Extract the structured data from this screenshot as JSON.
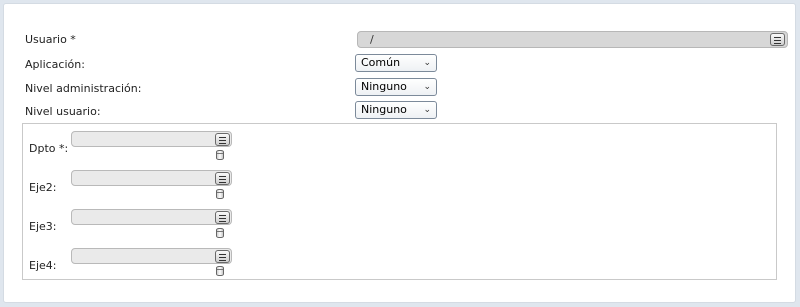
{
  "form": {
    "usuario": {
      "label": "Usuario *",
      "value": "/",
      "list_icon": "list-icon"
    },
    "aplicacion": {
      "label": "Aplicación:",
      "selected": "Común"
    },
    "nivel_admin": {
      "label": "Nivel administración:",
      "selected": "Ninguno"
    },
    "nivel_usuario": {
      "label": "Nivel usuario:",
      "selected": "Ninguno"
    },
    "dims": [
      {
        "label": "Dpto *:",
        "value": ""
      },
      {
        "label": "Eje2:",
        "value": ""
      },
      {
        "label": "Eje3:",
        "value": ""
      },
      {
        "label": "Eje4:",
        "value": ""
      }
    ]
  },
  "icons": {
    "select_arrow": "chevron-down-icon",
    "list": "list-icon",
    "database": "database-icon"
  }
}
